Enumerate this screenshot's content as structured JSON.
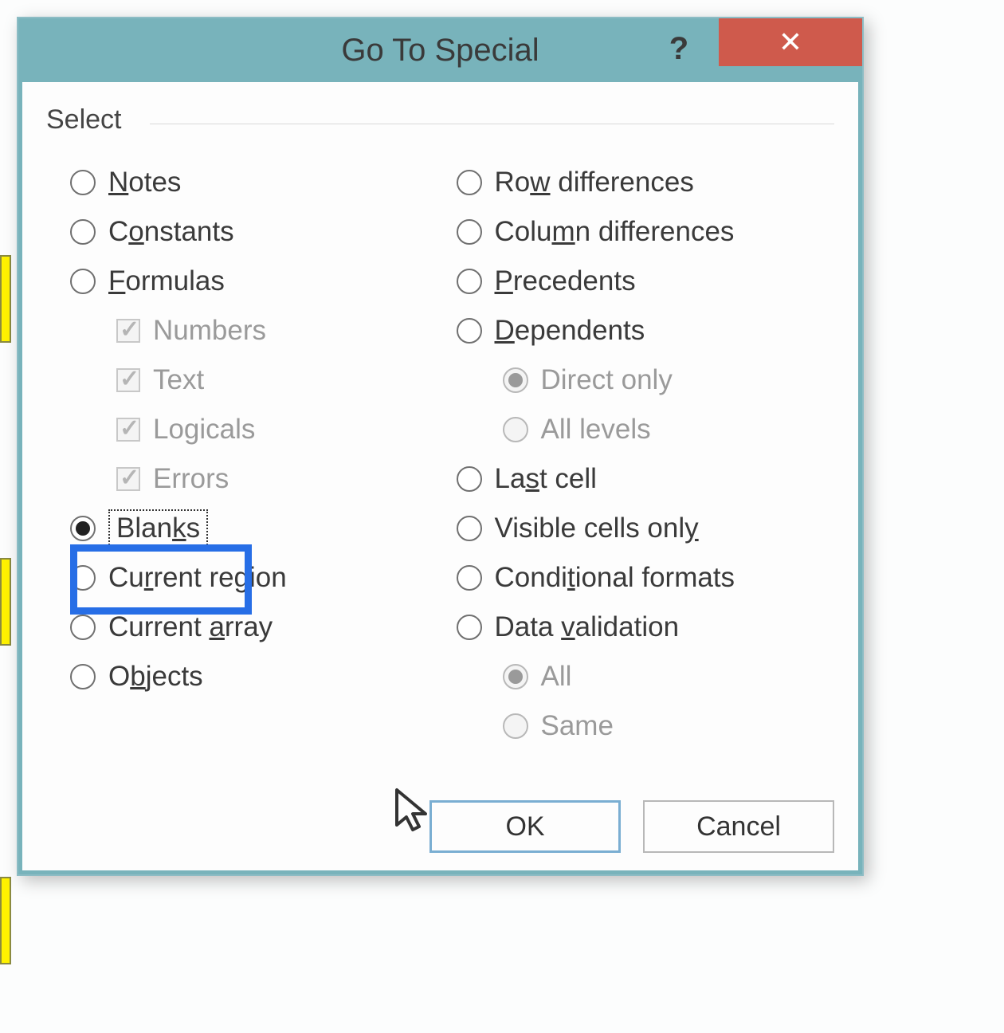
{
  "titlebar": {
    "title": "Go To Special",
    "help": "?",
    "close_icon": "✕"
  },
  "group_label": "Select",
  "left_options": [
    {
      "key": "notes",
      "type": "radio",
      "label": "Notes",
      "u": "N",
      "selected": false
    },
    {
      "key": "constants",
      "type": "radio",
      "label": "Constants",
      "u": "o",
      "selected": false
    },
    {
      "key": "formulas",
      "type": "radio",
      "label": "Formulas",
      "u": "F",
      "selected": false
    },
    {
      "key": "numbers",
      "type": "check",
      "label": "Numbers",
      "checked": true,
      "disabled": true,
      "sub": true
    },
    {
      "key": "text",
      "type": "check",
      "label": "Text",
      "checked": true,
      "disabled": true,
      "sub": true
    },
    {
      "key": "logicals",
      "type": "check",
      "label": "Logicals",
      "checked": true,
      "disabled": true,
      "sub": true
    },
    {
      "key": "errors",
      "type": "check",
      "label": "Errors",
      "checked": true,
      "disabled": true,
      "sub": true
    },
    {
      "key": "blanks",
      "type": "radio",
      "label": "Blanks",
      "u": "k",
      "selected": true,
      "focused": true
    },
    {
      "key": "current-region",
      "type": "radio",
      "label": "Current region",
      "u": "r",
      "selected": false
    },
    {
      "key": "current-array",
      "type": "radio",
      "label": "Current array",
      "u": "a",
      "selected": false
    },
    {
      "key": "objects",
      "type": "radio",
      "label": "Objects",
      "u": "b",
      "selected": false
    }
  ],
  "right_options": [
    {
      "key": "row-diff",
      "type": "radio",
      "label": "Row differences",
      "u": "w",
      "selected": false
    },
    {
      "key": "col-diff",
      "type": "radio",
      "label": "Column differences",
      "u": "m",
      "selected": false
    },
    {
      "key": "precedents",
      "type": "radio",
      "label": "Precedents",
      "u": "P",
      "selected": false
    },
    {
      "key": "dependents",
      "type": "radio",
      "label": "Dependents",
      "u": "D",
      "selected": false
    },
    {
      "key": "direct-only",
      "type": "radio",
      "label": "Direct only",
      "disabled": true,
      "selected": true,
      "sub": true
    },
    {
      "key": "all-levels",
      "type": "radio",
      "label": "All levels",
      "disabled": true,
      "selected": false,
      "sub": true
    },
    {
      "key": "last-cell",
      "type": "radio",
      "label": "Last cell",
      "u": "s",
      "selected": false
    },
    {
      "key": "visible-cells",
      "type": "radio",
      "label": "Visible cells only",
      "u": "y",
      "selected": false
    },
    {
      "key": "cond-formats",
      "type": "radio",
      "label": "Conditional formats",
      "u": "t",
      "selected": false
    },
    {
      "key": "data-validation",
      "type": "radio",
      "label": "Data validation",
      "u": "v",
      "selected": false
    },
    {
      "key": "all",
      "type": "radio",
      "label": "All",
      "disabled": true,
      "selected": true,
      "sub": true
    },
    {
      "key": "same",
      "type": "radio",
      "label": "Same",
      "disabled": true,
      "selected": false,
      "sub": true
    }
  ],
  "buttons": {
    "ok": "OK",
    "cancel": "Cancel"
  },
  "highlight": {
    "target": "blanks",
    "color": "#276ee6"
  }
}
